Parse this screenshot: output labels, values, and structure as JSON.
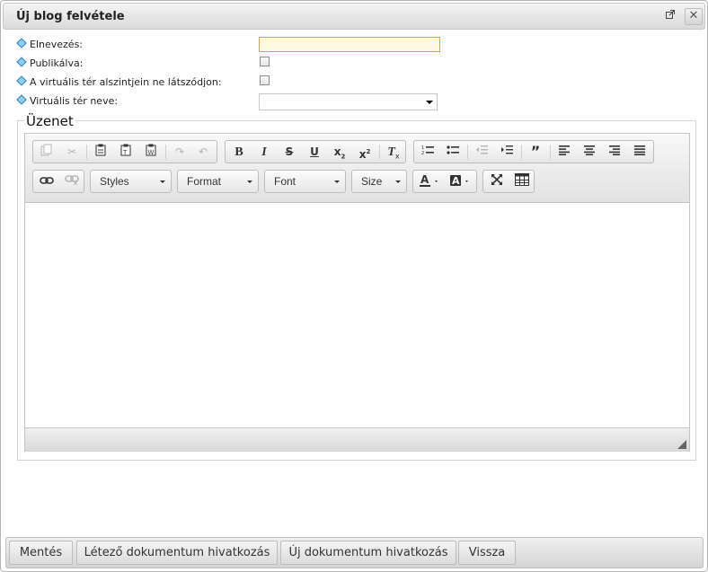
{
  "window": {
    "title": "Új blog felvétele",
    "popout_icon": "external-window-icon",
    "close_label": "✕"
  },
  "form": {
    "name_label": "Elnevezés:",
    "name_value": "",
    "published_label": "Publikálva:",
    "published_checked": false,
    "hide_label": "A virtuális tér alszintjein ne látszódjon:",
    "hide_checked": false,
    "space_label": "Virtuális tér neve:",
    "space_selected": ""
  },
  "message": {
    "legend": "Üzenet",
    "content": ""
  },
  "editor": {
    "row1_icons": [
      "copy-icon",
      "cut-icon",
      "paste-icon",
      "paste-text-icon",
      "paste-word-icon",
      "redo-icon",
      "undo-icon",
      "bold-icon",
      "italic-icon",
      "strikethrough-icon",
      "underline-icon",
      "subscript-icon",
      "superscript-icon",
      "remove-format-icon",
      "numbered-list-icon",
      "bulleted-list-icon",
      "outdent-icon",
      "indent-icon",
      "blockquote-icon",
      "align-left-icon",
      "align-center-icon",
      "align-right-icon",
      "justify-icon"
    ],
    "styles_label": "Styles",
    "format_label": "Format",
    "font_label": "Font",
    "size_label": "Size",
    "row2_icons": [
      "link-icon",
      "unlink-icon",
      "text-color-icon",
      "background-color-icon",
      "maximize-icon",
      "table-icon"
    ]
  },
  "buttons": {
    "save": "Mentés",
    "existing_doc": "Létező dokumentum hivatkozás",
    "new_doc": "Új dokumentum hivatkozás",
    "back": "Vissza"
  }
}
